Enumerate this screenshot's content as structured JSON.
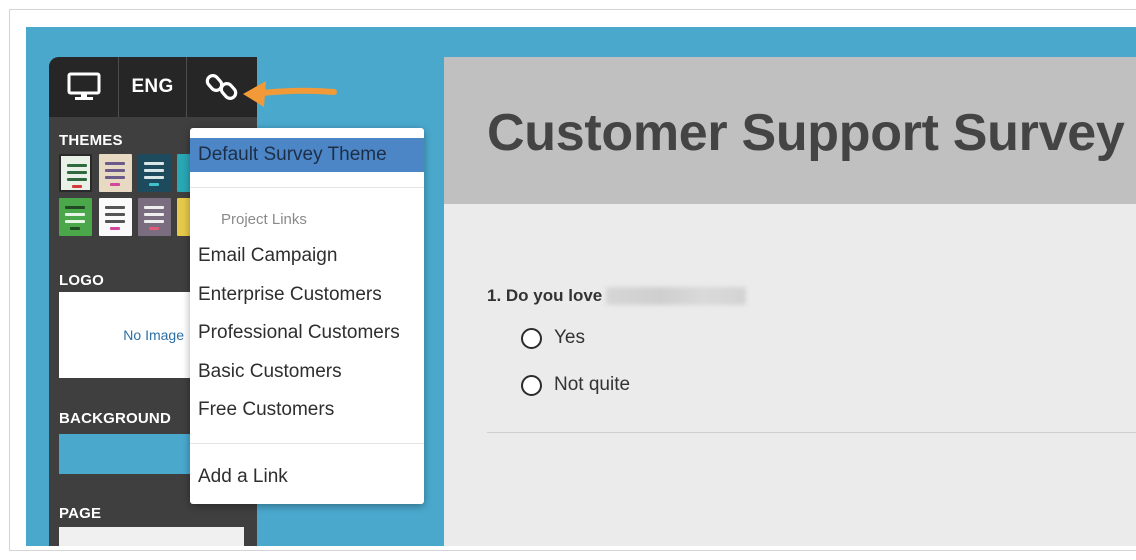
{
  "colors": {
    "accent_blue": "#4aa8cd",
    "panel_dark": "#3f3f3f",
    "toolbar_dark": "#262626",
    "dropdown_active": "#4c86c6",
    "arrow_orange": "#f29a38"
  },
  "toolbar": {
    "desktop_icon": "monitor-icon",
    "language_label": "ENG",
    "link_icon": "link-icon"
  },
  "sidebar": {
    "themes_label": "THEMES",
    "logo_label": "LOGO",
    "logo_placeholder": "No Image",
    "background_label": "BACKGROUND",
    "page_label": "PAGE"
  },
  "dropdown": {
    "selected": "Default Survey Theme",
    "section_heading": "Project Links",
    "links": [
      "Email Campaign",
      "Enterprise Customers",
      "Professional Customers",
      "Basic Customers",
      "Free Customers"
    ],
    "add_link": "Add a Link"
  },
  "survey": {
    "title": "Customer Support Survey",
    "question": "1. Do you love",
    "options": [
      "Yes",
      "Not quite"
    ]
  }
}
